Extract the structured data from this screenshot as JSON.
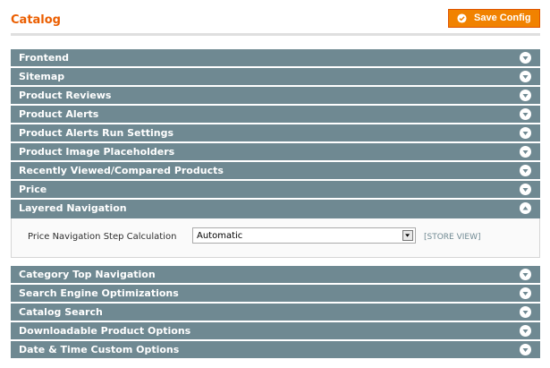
{
  "header": {
    "title": "Catalog",
    "save_label": "Save Config",
    "save_icon": "check-circle-icon"
  },
  "colors": {
    "accent": "#eb5e00",
    "button": "#f18200",
    "section_bar": "#6f8992",
    "panel_bg": "#fafafa"
  },
  "sections": [
    {
      "label": "Frontend",
      "state": "collapsed"
    },
    {
      "label": "Sitemap",
      "state": "collapsed"
    },
    {
      "label": "Product Reviews",
      "state": "collapsed"
    },
    {
      "label": "Product Alerts",
      "state": "collapsed"
    },
    {
      "label": "Product Alerts Run Settings",
      "state": "collapsed"
    },
    {
      "label": "Product Image Placeholders",
      "state": "collapsed"
    },
    {
      "label": "Recently Viewed/Compared Products",
      "state": "collapsed"
    },
    {
      "label": "Price",
      "state": "collapsed"
    },
    {
      "label": "Layered Navigation",
      "state": "expanded"
    },
    {
      "label": "Category Top Navigation",
      "state": "collapsed"
    },
    {
      "label": "Search Engine Optimizations",
      "state": "collapsed"
    },
    {
      "label": "Catalog Search",
      "state": "collapsed"
    },
    {
      "label": "Downloadable Product Options",
      "state": "collapsed"
    },
    {
      "label": "Date & Time Custom Options",
      "state": "collapsed"
    }
  ],
  "layered_navigation": {
    "field_label": "Price Navigation Step Calculation",
    "field_value": "Automatic",
    "scope": "[STORE VIEW]"
  }
}
